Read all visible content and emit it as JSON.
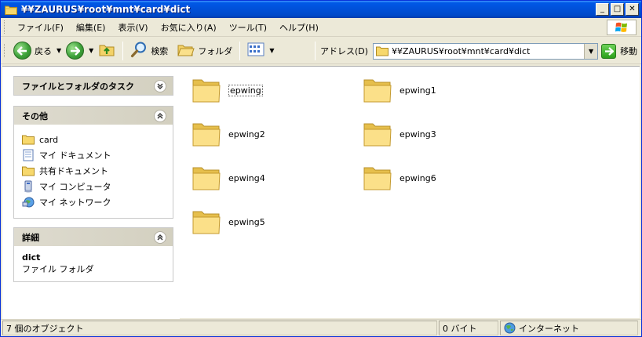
{
  "window": {
    "title": "¥¥ZAURUS¥root¥mnt¥card¥dict",
    "minimize_glyph": "_",
    "maximize_glyph": "□",
    "close_glyph": "✕"
  },
  "menu": {
    "items": [
      {
        "label": "ファイル(F)"
      },
      {
        "label": "編集(E)"
      },
      {
        "label": "表示(V)"
      },
      {
        "label": "お気に入り(A)"
      },
      {
        "label": "ツール(T)"
      },
      {
        "label": "ヘルプ(H)"
      }
    ]
  },
  "toolbar": {
    "back_label": "戻る",
    "search_label": "検索",
    "folders_label": "フォルダ",
    "address_label": "アドレス(D)",
    "address_value": "¥¥ZAURUS¥root¥mnt¥card¥dict",
    "go_label": "移動"
  },
  "taskpane": {
    "file_folder_tasks": {
      "title": "ファイルとフォルダのタスク"
    },
    "other_places": {
      "title": "その他",
      "items": [
        {
          "label": "card",
          "icon": "folder-icon"
        },
        {
          "label": "マイ ドキュメント",
          "icon": "my-documents-icon"
        },
        {
          "label": "共有ドキュメント",
          "icon": "shared-documents-icon"
        },
        {
          "label": "マイ コンピュータ",
          "icon": "my-computer-icon"
        },
        {
          "label": "マイ ネットワーク",
          "icon": "my-network-icon"
        }
      ]
    },
    "details": {
      "title": "詳細",
      "name": "dict",
      "type": "ファイル フォルダ"
    }
  },
  "folders": [
    {
      "label": "epwing"
    },
    {
      "label": "epwing1"
    },
    {
      "label": "epwing2"
    },
    {
      "label": "epwing3"
    },
    {
      "label": "epwing4"
    },
    {
      "label": "epwing6"
    },
    {
      "label": "epwing5"
    }
  ],
  "statusbar": {
    "objects": "7 個のオブジェクト",
    "size": "0 バイト",
    "zone": "インターネット"
  },
  "colors": {
    "titlebar": "#0058e6",
    "folder_yellow": "#f5d76b",
    "chrome": "#ece9d8"
  }
}
